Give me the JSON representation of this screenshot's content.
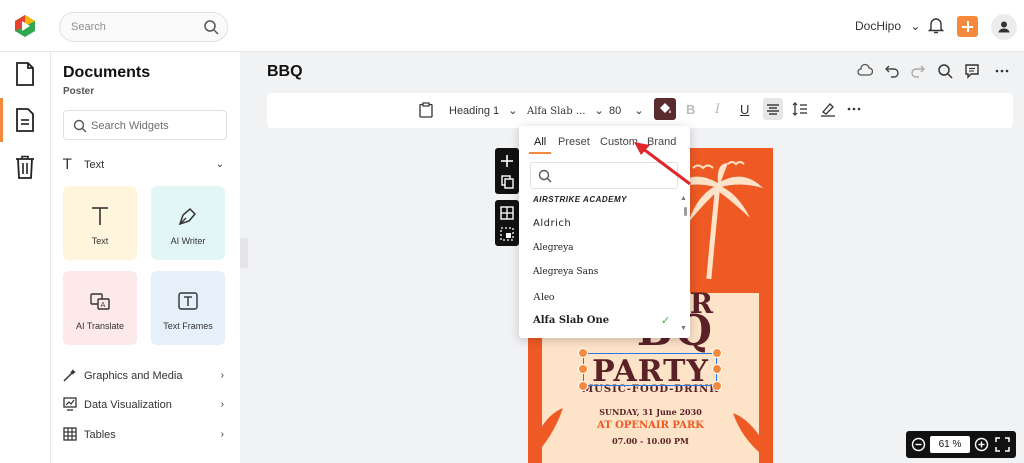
{
  "topbar": {
    "search_placeholder": "Search",
    "account_name": "DocHipo"
  },
  "panel": {
    "title": "Documents",
    "subtitle": "Poster",
    "search_placeholder": "Search Widgets",
    "text_section": "Text",
    "tiles": [
      {
        "label": "Text"
      },
      {
        "label": "AI Writer"
      },
      {
        "label": "AI Translate"
      },
      {
        "label": "Text Frames"
      }
    ],
    "sections": [
      {
        "label": "Graphics and Media"
      },
      {
        "label": "Data Visualization"
      },
      {
        "label": "Tables"
      }
    ]
  },
  "document": {
    "title": "BBQ"
  },
  "toolbar": {
    "text_style": "Heading 1",
    "font": "Alfa Slab ...",
    "font_size": "80"
  },
  "font_dropdown": {
    "tabs": [
      "All",
      "Preset",
      "Custom",
      "Brand"
    ],
    "active_tab": "All",
    "fonts": [
      "AIRSTRIKE ACADEMY",
      "Aldrich",
      "Alegreya",
      "Alegreya Sans",
      "Aleo",
      "Alfa Slab One"
    ],
    "selected_font": "Alfa Slab One"
  },
  "poster": {
    "line1": "ER",
    "line2": "BQ",
    "line3": "PARTY",
    "line4": "MUSIC-FOOD-DRINK",
    "date": "SUNDAY, 31 June 2030",
    "venue": "AT OPENAIR PARK",
    "time": "07.00 - 10.00 PM"
  },
  "zoom": {
    "value": "61 %"
  },
  "colors": {
    "accent": "#f58a3f",
    "poster_bg": "#ef5a24",
    "poster_text": "#5a2127",
    "annotation_arrow": "#e0262b"
  }
}
